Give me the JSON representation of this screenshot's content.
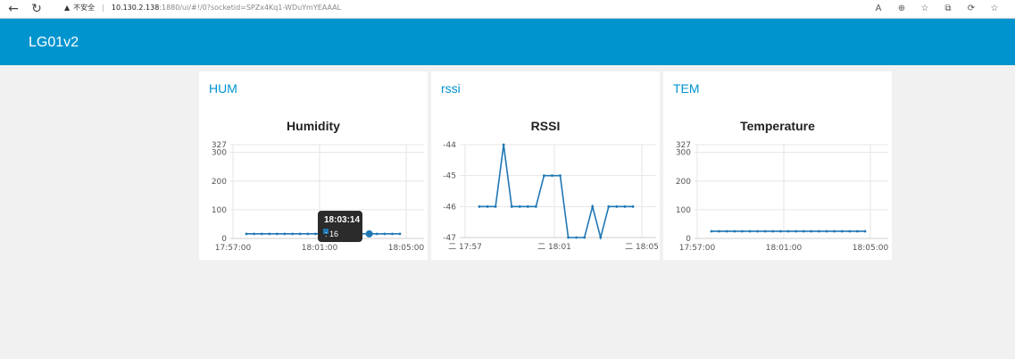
{
  "browser": {
    "warning": "不安全",
    "url_host": "10.130.2.138",
    "url_path": ":1880/ui/#!/0?socketid=SPZx4Kq1-WDuYmYEAAAL",
    "icons": [
      "back-icon",
      "reload-icon",
      "read-aloud-icon",
      "zoom-icon",
      "favorite-add-icon",
      "collections-icon",
      "extensions-icon",
      "favorites-icon"
    ],
    "icon_glyphs": [
      "←",
      "↻",
      "A",
      "⊕",
      "☆",
      "⧉",
      "⟳",
      "☆"
    ]
  },
  "header": {
    "title": "LG01v2"
  },
  "cards": [
    {
      "label": "HUM",
      "title": "Humidity"
    },
    {
      "label": "rssi",
      "title": "RSSI"
    },
    {
      "label": "TEM",
      "title": "Temperature"
    }
  ],
  "chart_data": [
    {
      "type": "line",
      "title": "Humidity",
      "y_ticks": [
        "327",
        "300",
        "200",
        "100",
        "0"
      ],
      "x_ticks": [
        "17:57:00",
        "18:01:00",
        "18:05:00"
      ],
      "ylim": [
        0,
        327
      ],
      "series": [
        {
          "values": [
            16,
            16,
            16,
            16,
            16,
            16,
            16,
            16,
            16,
            16,
            16,
            16,
            16,
            16,
            16,
            16,
            16,
            16,
            16,
            16,
            16
          ]
        }
      ],
      "color": "#1f77b4",
      "tooltip": {
        "time": "18:03:14",
        "value": ": 16"
      }
    },
    {
      "type": "line",
      "title": "RSSI",
      "y_ticks": [
        "-44",
        "-45",
        "-46",
        "-47"
      ],
      "x_ticks": [
        "二 17:57",
        "二 18:01",
        "二 18:05"
      ],
      "ylim": [
        -47,
        -44
      ],
      "series": [
        {
          "values": [
            -46,
            -46,
            -46,
            -44,
            -46,
            -46,
            -46,
            -46,
            -45,
            -45,
            -45,
            -47,
            -47,
            -47,
            -46,
            -47,
            -46,
            -46,
            -46,
            -46
          ]
        }
      ],
      "color": "#1f77b4"
    },
    {
      "type": "line",
      "title": "Temperature",
      "y_ticks": [
        "327",
        "300",
        "200",
        "100",
        "0"
      ],
      "x_ticks": [
        "17:57:00",
        "18:01:00",
        "18:05:00"
      ],
      "ylim": [
        0,
        327
      ],
      "series": [
        {
          "values": [
            25,
            25,
            25,
            25,
            25,
            25,
            25,
            25,
            25,
            25,
            25,
            25,
            25,
            25,
            25,
            25,
            25,
            25,
            25,
            25,
            25
          ]
        }
      ],
      "color": "#1f77b4"
    }
  ]
}
